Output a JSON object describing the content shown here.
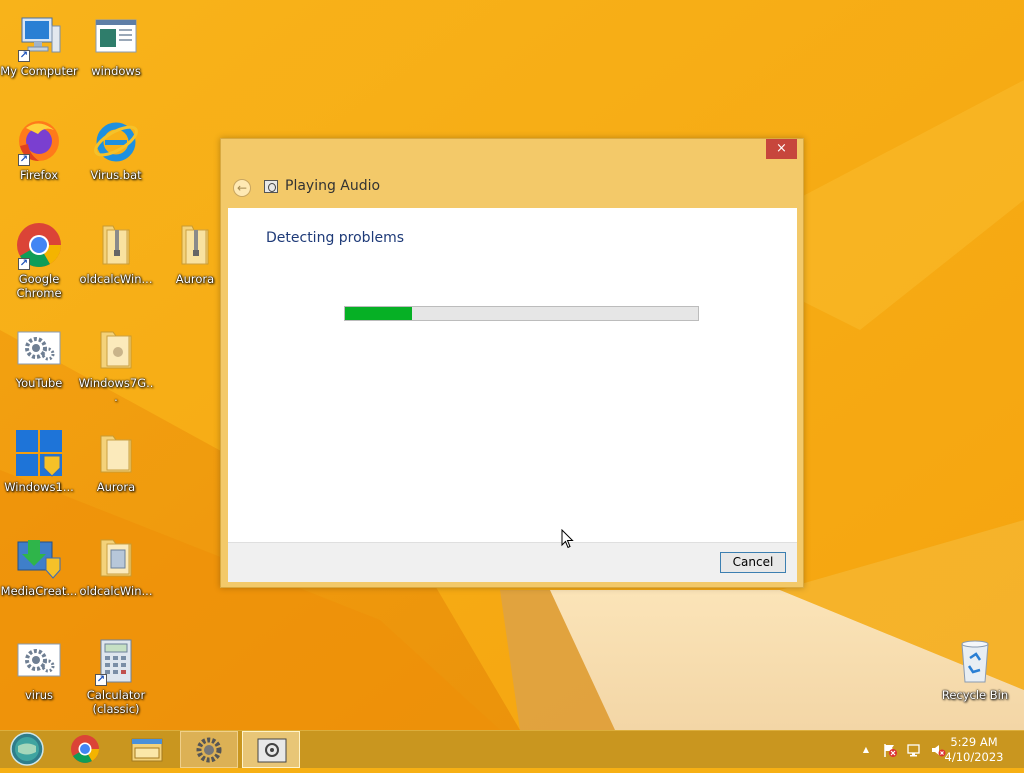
{
  "desktop": {
    "icons": [
      {
        "label": "My Computer"
      },
      {
        "label": "windows"
      },
      {
        "label": "Firefox"
      },
      {
        "label": "Virus.bat"
      },
      {
        "label": "Google Chrome"
      },
      {
        "label": "oldcalcWin..."
      },
      {
        "label": "Aurora"
      },
      {
        "label": "YouTube"
      },
      {
        "label": "Windows7G..."
      },
      {
        "label": "Windows1..."
      },
      {
        "label": "Aurora"
      },
      {
        "label": "MediaCreat..."
      },
      {
        "label": "oldcalcWin..."
      },
      {
        "label": "virus"
      },
      {
        "label": "Calculator (classic)"
      },
      {
        "label": "Recycle Bin"
      }
    ]
  },
  "dialog": {
    "title": "Playing Audio",
    "heading": "Detecting problems",
    "progress": 0.19,
    "cancel_label": "Cancel",
    "close_glyph": "×",
    "back_glyph": "←"
  },
  "taskbar": {
    "clock_time": "5:29 AM",
    "clock_date": "4/10/2023",
    "tray_arrow": "▲"
  },
  "colors": {
    "progress_fill": "#06b025",
    "close_button": "#c7463c",
    "heading": "#1e3a78",
    "wallpaper": "#f7b014"
  }
}
